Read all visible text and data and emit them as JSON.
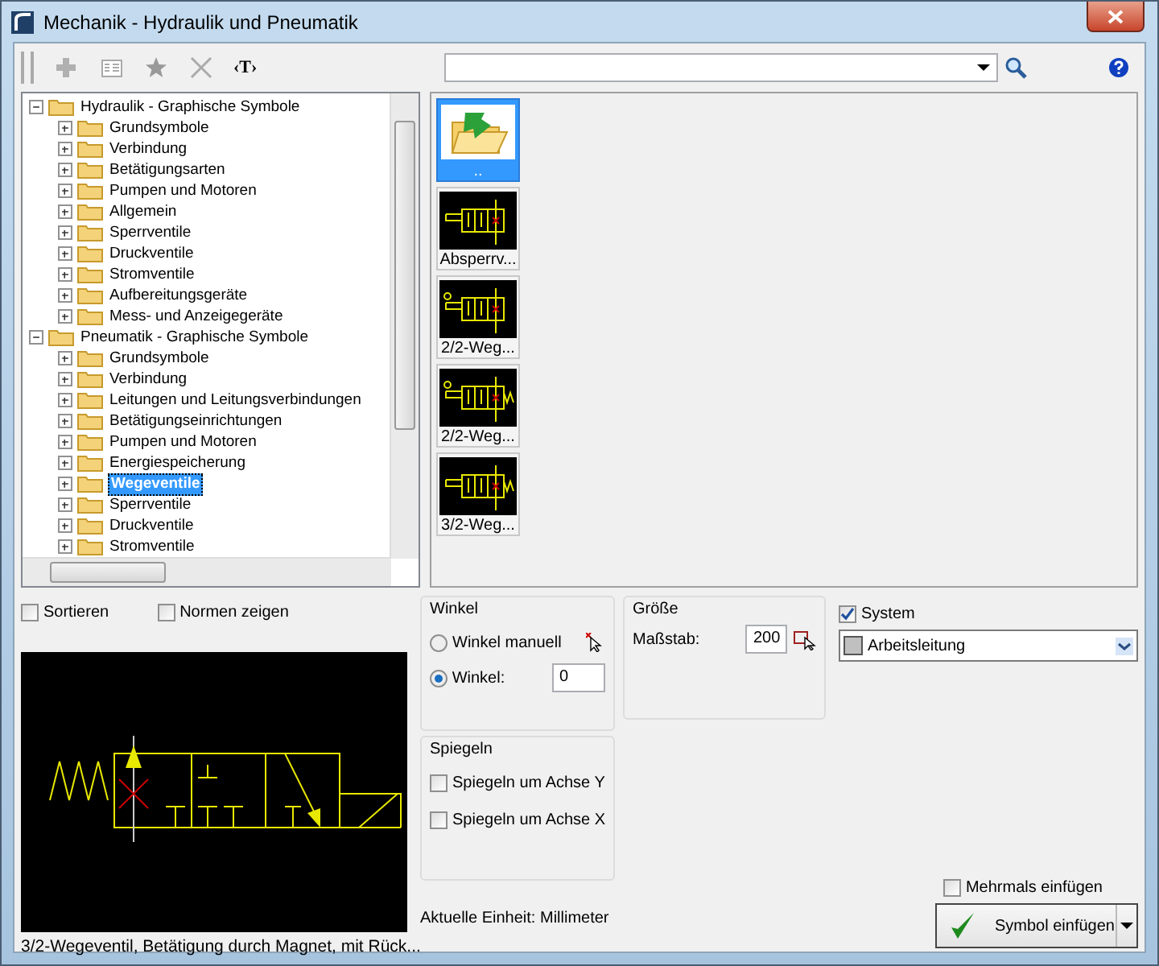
{
  "window": {
    "title": "Mechanik - Hydraulik und Pneumatik"
  },
  "toolbar": {
    "text_tool": "‹T›"
  },
  "tree": [
    {
      "label": "Hydraulik - Graphische Symbole",
      "expanded": true,
      "selected": false,
      "children": [
        {
          "label": "Grundsymbole",
          "expanded": false,
          "selected": false
        },
        {
          "label": "Verbindung",
          "expanded": false,
          "selected": false
        },
        {
          "label": "Betätigungsarten",
          "expanded": false,
          "selected": false
        },
        {
          "label": "Pumpen und Motoren",
          "expanded": false,
          "selected": false
        },
        {
          "label": "Allgemein",
          "expanded": false,
          "selected": false
        },
        {
          "label": "Sperrventile",
          "expanded": false,
          "selected": false
        },
        {
          "label": "Druckventile",
          "expanded": false,
          "selected": false
        },
        {
          "label": "Stromventile",
          "expanded": false,
          "selected": false
        },
        {
          "label": "Aufbereitungsgeräte",
          "expanded": false,
          "selected": false
        },
        {
          "label": "Mess- und Anzeigegeräte",
          "expanded": false,
          "selected": false
        }
      ]
    },
    {
      "label": "Pneumatik - Graphische Symbole",
      "expanded": true,
      "selected": false,
      "children": [
        {
          "label": "Grundsymbole",
          "expanded": false,
          "selected": false
        },
        {
          "label": "Verbindung",
          "expanded": false,
          "selected": false
        },
        {
          "label": "Leitungen und Leitungsverbindungen",
          "expanded": false,
          "selected": false
        },
        {
          "label": "Betätigungseinrichtungen",
          "expanded": false,
          "selected": false
        },
        {
          "label": "Pumpen und Motoren",
          "expanded": false,
          "selected": false
        },
        {
          "label": "Energiespeicherung",
          "expanded": false,
          "selected": false
        },
        {
          "label": "Wegeventile",
          "expanded": false,
          "selected": true
        },
        {
          "label": "Sperrventile",
          "expanded": false,
          "selected": false
        },
        {
          "label": "Druckventile",
          "expanded": false,
          "selected": false
        },
        {
          "label": "Stromventile",
          "expanded": false,
          "selected": false
        }
      ]
    }
  ],
  "thumbnails": [
    {
      "kind": "folder",
      "label": "..",
      "selected": true
    },
    {
      "kind": "symbol",
      "label": "Absperrv...",
      "selected": false
    },
    {
      "kind": "symbol",
      "label": "2/2-Weg...",
      "selected": false
    },
    {
      "kind": "symbol",
      "label": "2/2-Weg...",
      "selected": false
    },
    {
      "kind": "symbol",
      "label": "3/2-Weg...",
      "selected": false
    }
  ],
  "options": [
    {
      "label": "Sortieren",
      "checked": false
    },
    {
      "label": "Normen zeigen",
      "checked": false
    }
  ],
  "preview": {
    "caption": "3/2-Wegeventil, Betätigung durch Magnet, mit Rück..."
  },
  "winkel": {
    "title": "Winkel",
    "radios": [
      {
        "label": "Winkel manuell",
        "selected": false
      },
      {
        "label": "Winkel:",
        "selected": true
      }
    ],
    "value": "0"
  },
  "groesse": {
    "title": "Größe",
    "label": "Maßstab:",
    "value": "200"
  },
  "spiegeln": {
    "title": "Spiegeln",
    "checks": [
      {
        "label": "Spiegeln um Achse Y",
        "checked": false
      },
      {
        "label": "Spiegeln um Achse X",
        "checked": false
      }
    ]
  },
  "unit_text": "Aktuelle Einheit: Millimeter",
  "system": {
    "label": "System",
    "checked": true,
    "value": "Arbeitsleitung"
  },
  "multiple": {
    "label": "Mehrmals einfügen",
    "checked": false
  },
  "insert_button": {
    "label": "Symbol einfügen"
  }
}
